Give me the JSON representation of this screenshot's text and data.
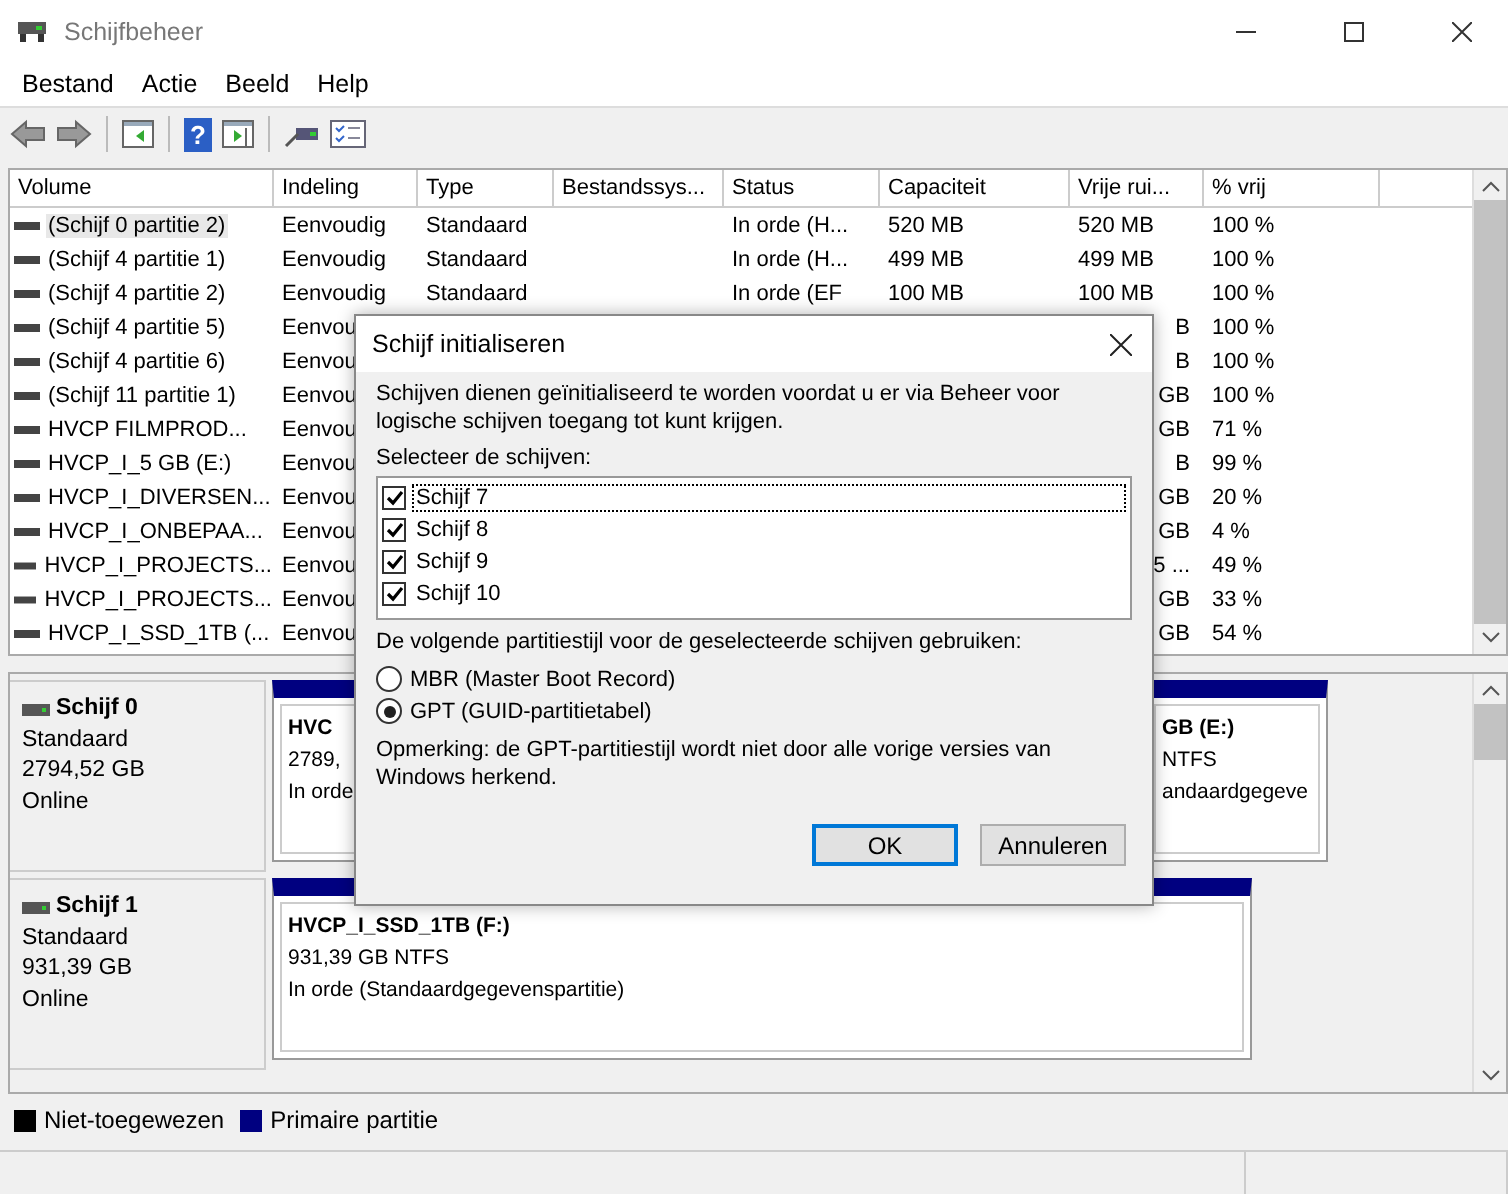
{
  "window": {
    "title": "Schijfbeheer"
  },
  "menu": [
    "Bestand",
    "Actie",
    "Beeld",
    "Help"
  ],
  "toolbar": [
    {
      "kind": "back"
    },
    {
      "kind": "forward"
    },
    {
      "kind": "separator"
    },
    {
      "kind": "tree"
    },
    {
      "kind": "separator"
    },
    {
      "kind": "help",
      "glyph": "?"
    },
    {
      "kind": "pane"
    },
    {
      "kind": "separator"
    },
    {
      "kind": "connect"
    },
    {
      "kind": "properties"
    }
  ],
  "volumes": {
    "columns": [
      "Volume",
      "Indeling",
      "Type",
      "Bestandssys...",
      "Status",
      "Capaciteit",
      "Vrije rui...",
      "% vrij"
    ],
    "rows": [
      {
        "volume": "(Schijf 0 partitie 2)",
        "layout": "Eenvoudig",
        "type": "Standaard",
        "status": "In orde (H...",
        "capacity": "520 MB",
        "free": "520 MB",
        "pct": "100 %",
        "selected": true
      },
      {
        "volume": "(Schijf 4 partitie 1)",
        "layout": "Eenvoudig",
        "type": "Standaard",
        "status": "In orde (H...",
        "capacity": "499 MB",
        "free": "499 MB",
        "pct": "100 %",
        "selected": false
      },
      {
        "volume": "(Schijf 4 partitie 2)",
        "layout": "Eenvoudig",
        "type": "Standaard",
        "status": "In orde (EF",
        "capacity": "100 MB",
        "free": "100 MB",
        "pct": "100 %",
        "selected": false
      },
      {
        "volume": "(Schijf 4 partitie 5)",
        "layout": "Eenvou",
        "free": "B",
        "pct": "100 %",
        "selected": false
      },
      {
        "volume": "(Schijf 4 partitie 6)",
        "layout": "Eenvou",
        "free": "B",
        "pct": "100 %",
        "selected": false
      },
      {
        "volume": "(Schijf 11 partitie 1)",
        "layout": "Eenvou",
        "free": "GB",
        "pct": "100 %",
        "selected": false
      },
      {
        "volume": "HVCP FILMPROD...",
        "layout": "Eenvou",
        "free": "GB",
        "pct": "71 %",
        "selected": false
      },
      {
        "volume": "HVCP_I_5 GB (E:)",
        "layout": "Eenvou",
        "free": "B",
        "pct": "99 %",
        "selected": false
      },
      {
        "volume": "HVCP_I_DIVERSEN...",
        "layout": "Eenvou",
        "free": "GB",
        "pct": "20 %",
        "selected": false
      },
      {
        "volume": "HVCP_I_ONBEPAA...",
        "layout": "Eenvou",
        "free": "GB",
        "pct": "4 %",
        "selected": false
      },
      {
        "volume": "HVCP_I_PROJECTS...",
        "layout": "Eenvou",
        "free": "5 ...",
        "pct": "49 %",
        "selected": false
      },
      {
        "volume": "HVCP_I_PROJECTS...",
        "layout": "Eenvou",
        "free": "GB",
        "pct": "33 %",
        "selected": false
      },
      {
        "volume": "HVCP_I_SSD_1TB (...",
        "layout": "Eenvou",
        "free": "GB",
        "pct": "54 %",
        "selected": false
      }
    ]
  },
  "disks": [
    {
      "name": "Schijf 0",
      "type": "Standaard",
      "size": "2794,52 GB",
      "status": "Online",
      "partitions": [
        {
          "title": "HVC",
          "lines": [
            "2789,",
            "In orde"
          ]
        },
        {
          "title": "GB  (E:)",
          "lines": [
            "NTFS",
            "andaardgegeve"
          ]
        }
      ]
    },
    {
      "name": "Schijf 1",
      "type": "Standaard",
      "size": "931,39 GB",
      "status": "Online",
      "partitions": [
        {
          "title": "HVCP_I_SSD_1TB  (F:)",
          "lines": [
            "931,39 GB NTFS",
            "In orde (Standaardgegevenspartitie)"
          ]
        }
      ]
    }
  ],
  "legend": [
    {
      "label": "Niet-toegewezen",
      "color": "#000000"
    },
    {
      "label": "Primaire partitie",
      "color": "#000080"
    }
  ],
  "dialog": {
    "title": "Schijf initialiseren",
    "intro": "Schijven dienen geïnitialiseerd te worden voordat u er via Beheer voor logische schijven toegang tot kunt krijgen.",
    "list_label": "Selecteer de schijven:",
    "disks": [
      {
        "label": "Schijf 7",
        "checked": true,
        "focused": true
      },
      {
        "label": "Schijf 8",
        "checked": true,
        "focused": false
      },
      {
        "label": "Schijf 9",
        "checked": true,
        "focused": false
      },
      {
        "label": "Schijf 10",
        "checked": true,
        "focused": false
      }
    ],
    "style_label": "De volgende partitiestijl voor de geselecteerde schijven gebruiken:",
    "styles": [
      {
        "label": "MBR (Master Boot Record)",
        "selected": false
      },
      {
        "label": "GPT (GUID-partitietabel)",
        "selected": true
      }
    ],
    "note": "Opmerking: de GPT-partitiestijl wordt niet door alle vorige versies van Windows herkend.",
    "buttons": [
      {
        "label": "OK",
        "default": true
      },
      {
        "label": "Annuleren",
        "default": false
      }
    ]
  }
}
